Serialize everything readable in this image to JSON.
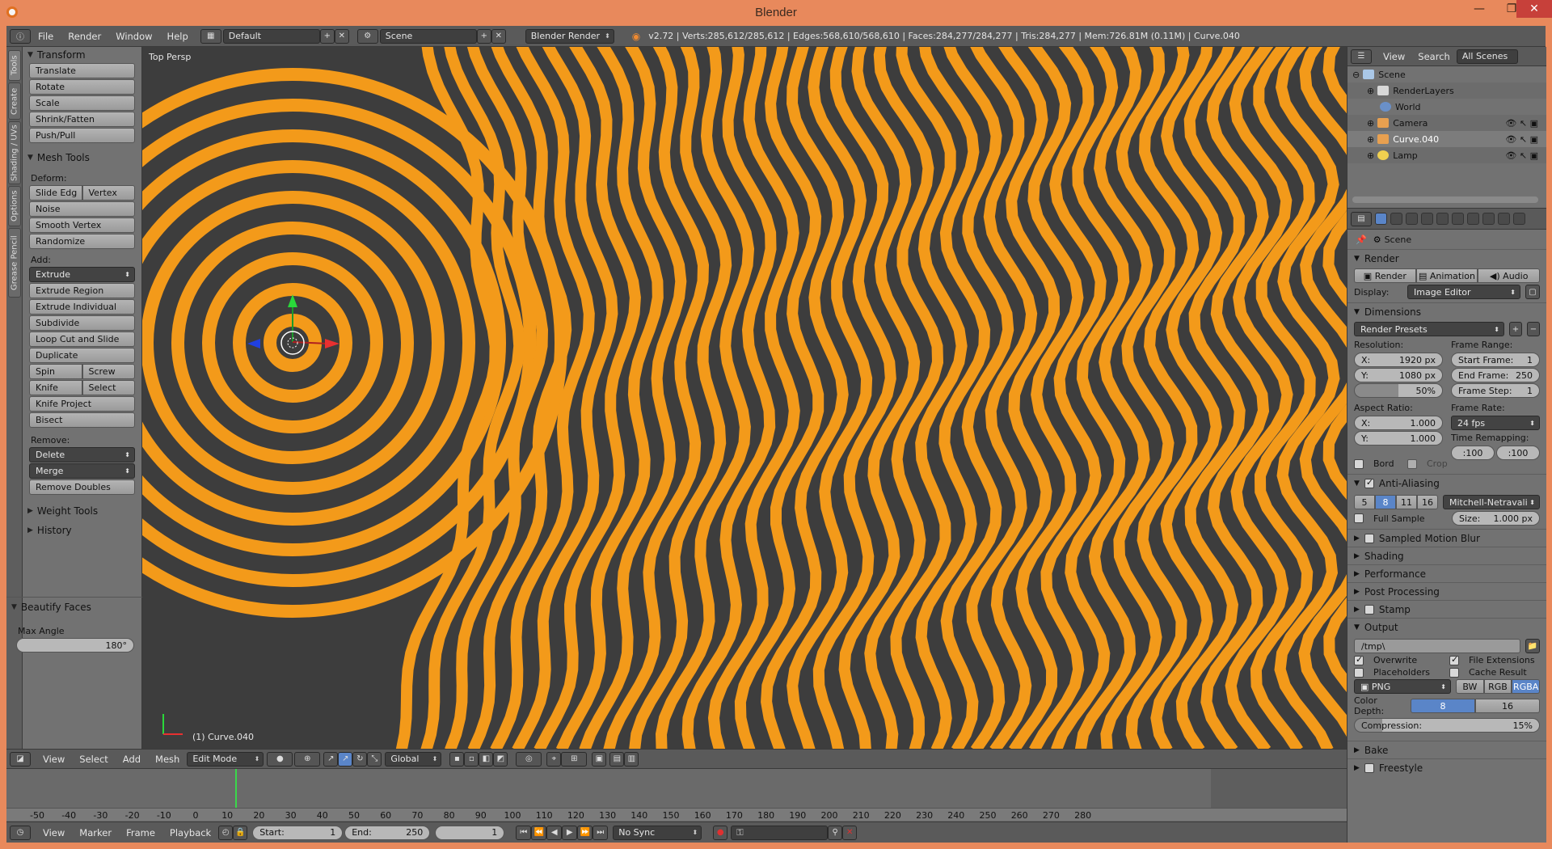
{
  "window": {
    "title": "Blender"
  },
  "menubar": {
    "items": [
      "File",
      "Render",
      "Window",
      "Help"
    ],
    "layout": "Default",
    "scene": "Scene",
    "engine": "Blender Render",
    "info": "v2.72 | Verts:285,612/285,612 | Edges:568,610/568,610 | Faces:284,277/284,277 | Tris:284,277 | Mem:726.81M (0.11M) | Curve.040"
  },
  "tooltabs": [
    "Tools",
    "Create",
    "Shading / UVs",
    "Options",
    "Grease Pencil"
  ],
  "toolshelf": {
    "transform": {
      "title": "Transform",
      "buttons": [
        "Translate",
        "Rotate",
        "Scale",
        "Shrink/Fatten",
        "Push/Pull"
      ]
    },
    "meshtools": {
      "title": "Mesh Tools",
      "deform_label": "Deform:",
      "slide_edge": "Slide Edg",
      "vertex": "Vertex",
      "noise": "Noise",
      "smooth_vertex": "Smooth Vertex",
      "randomize": "Randomize",
      "add_label": "Add:",
      "extrude": "Extrude",
      "extrude_region": "Extrude Region",
      "extrude_individual": "Extrude Individual",
      "subdivide": "Subdivide",
      "loop_cut": "Loop Cut and Slide",
      "duplicate": "Duplicate",
      "spin": "Spin",
      "screw": "Screw",
      "knife": "Knife",
      "select": "Select",
      "knife_project": "Knife Project",
      "bisect": "Bisect",
      "remove_label": "Remove:",
      "delete": "Delete",
      "merge": "Merge",
      "remove_doubles": "Remove Doubles"
    },
    "weight_tools": "Weight Tools",
    "history": "History",
    "beautify": {
      "title": "Beautify Faces",
      "max_angle_label": "Max Angle",
      "max_angle": "180°"
    }
  },
  "viewport": {
    "label": "Top Persp",
    "object": "(1) Curve.040"
  },
  "vpheader": {
    "items": [
      "View",
      "Select",
      "Add",
      "Mesh"
    ],
    "mode": "Edit Mode",
    "orientation": "Global"
  },
  "timeline": {
    "ticks": [
      "-50",
      "-40",
      "-30",
      "-20",
      "-10",
      "0",
      "10",
      "20",
      "30",
      "40",
      "50",
      "60",
      "70",
      "80",
      "90",
      "100",
      "110",
      "120",
      "130",
      "140",
      "150",
      "160",
      "170",
      "180",
      "190",
      "200",
      "210",
      "220",
      "230",
      "240",
      "250",
      "260",
      "270",
      "280"
    ],
    "menu": [
      "View",
      "Marker",
      "Frame",
      "Playback"
    ],
    "start_label": "Start:",
    "start": "1",
    "end_label": "End:",
    "end": "250",
    "current": "1",
    "sync": "No Sync"
  },
  "outliner": {
    "menu": [
      "View",
      "Search"
    ],
    "filter": "All Scenes",
    "rows": [
      "Scene",
      "RenderLayers",
      "World",
      "Camera",
      "Curve.040",
      "Lamp"
    ]
  },
  "properties": {
    "context": "Scene",
    "render": {
      "title": "Render",
      "render_btn": "Render",
      "animation_btn": "Animation",
      "audio_btn": "Audio",
      "display_label": "Display:",
      "display": "Image Editor"
    },
    "dimensions": {
      "title": "Dimensions",
      "presets": "Render Presets",
      "resolution_label": "Resolution:",
      "res_x_label": "X:",
      "res_x": "1920 px",
      "res_y_label": "Y:",
      "res_y": "1080 px",
      "res_pct": "50%",
      "frame_range_label": "Frame Range:",
      "start_label": "Start Frame:",
      "start": "1",
      "end_label": "End Frame:",
      "end": "250",
      "step_label": "Frame Step:",
      "step": "1",
      "aspect_label": "Aspect Ratio:",
      "asp_x_label": "X:",
      "asp_x": "1.000",
      "asp_y_label": "Y:",
      "asp_y": "1.000",
      "frame_rate_label": "Frame Rate:",
      "fps": "24 fps",
      "time_remap_label": "Time Remapping:",
      "remap_old": "100",
      "remap_new": "100",
      "bord": "Bord",
      "crop": "Crop"
    },
    "aa": {
      "title": "Anti-Aliasing",
      "samples": [
        "5",
        "8",
        "11",
        "16"
      ],
      "filter": "Mitchell-Netravali",
      "full_sample": "Full Sample",
      "size_label": "Size:",
      "size": "1.000 px"
    },
    "collapsed": [
      "Sampled Motion Blur",
      "Shading",
      "Performance",
      "Post Processing",
      "Stamp"
    ],
    "output": {
      "title": "Output",
      "path": "/tmp\\",
      "overwrite": "Overwrite",
      "file_ext": "File Extensions",
      "placeholders": "Placeholders",
      "cache": "Cache Result",
      "format": "PNG",
      "bw": "BW",
      "rgb": "RGB",
      "rgba": "RGBA",
      "depth_label": "Color Depth:",
      "depth8": "8",
      "depth16": "16",
      "compression_label": "Compression:",
      "compression": "15%"
    },
    "bake": "Bake",
    "freestyle": "Freestyle"
  }
}
